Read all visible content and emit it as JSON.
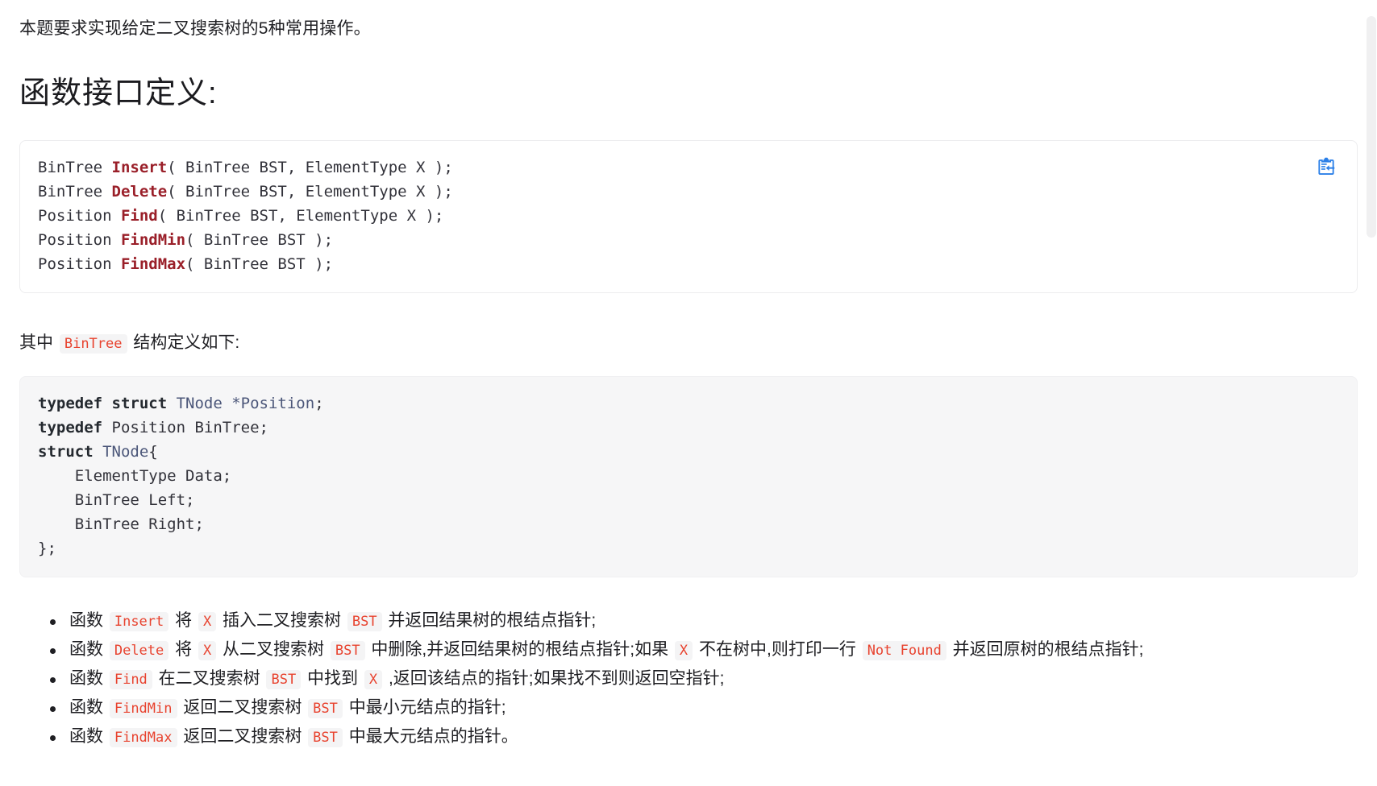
{
  "intro": {
    "text": "本题要求实现给定二叉搜索树的5种常用操作。"
  },
  "heading": {
    "text": "函数接口定义:"
  },
  "code_block_1": {
    "lines": [
      {
        "parts": [
          {
            "t": "BinTree ",
            "c": "plain"
          },
          {
            "t": "Insert",
            "c": "fn"
          },
          {
            "t": "( BinTree BST, ElementType X );",
            "c": "plain"
          }
        ]
      },
      {
        "parts": [
          {
            "t": "BinTree ",
            "c": "plain"
          },
          {
            "t": "Delete",
            "c": "fn"
          },
          {
            "t": "( BinTree BST, ElementType X );",
            "c": "plain"
          }
        ]
      },
      {
        "parts": [
          {
            "t": "Position ",
            "c": "plain"
          },
          {
            "t": "Find",
            "c": "fn"
          },
          {
            "t": "( BinTree BST, ElementType X );",
            "c": "plain"
          }
        ]
      },
      {
        "parts": [
          {
            "t": "Position ",
            "c": "plain"
          },
          {
            "t": "FindMin",
            "c": "fn"
          },
          {
            "t": "( BinTree BST );",
            "c": "plain"
          }
        ]
      },
      {
        "parts": [
          {
            "t": "Position ",
            "c": "plain"
          },
          {
            "t": "FindMax",
            "c": "fn"
          },
          {
            "t": "( BinTree BST );",
            "c": "plain"
          }
        ]
      }
    ],
    "copy_icon": "copy-to-clipboard-icon",
    "copy_icon_color": "#2a7fe8"
  },
  "mid_paragraph": {
    "before": "其中",
    "code": "BinTree",
    "after": "结构定义如下:"
  },
  "code_block_2": {
    "lines": [
      {
        "parts": [
          {
            "t": "typedef struct ",
            "c": "kw"
          },
          {
            "t": "TNode ",
            "c": "type"
          },
          {
            "t": "*Position",
            "c": "type"
          },
          {
            "t": ";",
            "c": "plain"
          }
        ]
      },
      {
        "parts": [
          {
            "t": "typedef ",
            "c": "kw"
          },
          {
            "t": "Position BinTree;",
            "c": "plain"
          }
        ]
      },
      {
        "parts": [
          {
            "t": "struct ",
            "c": "kw"
          },
          {
            "t": "TNode",
            "c": "type"
          },
          {
            "t": "{",
            "c": "plain"
          }
        ]
      },
      {
        "parts": [
          {
            "t": "    ElementType Data;",
            "c": "plain"
          }
        ]
      },
      {
        "parts": [
          {
            "t": "    BinTree Left;",
            "c": "plain"
          }
        ]
      },
      {
        "parts": [
          {
            "t": "    BinTree Right;",
            "c": "plain"
          }
        ]
      },
      {
        "parts": [
          {
            "t": "};",
            "c": "plain"
          }
        ]
      }
    ]
  },
  "spec_list": {
    "items": [
      {
        "segments": [
          {
            "type": "text",
            "v": "函数 "
          },
          {
            "type": "code",
            "v": "Insert"
          },
          {
            "type": "text",
            "v": " 将 "
          },
          {
            "type": "code",
            "v": "X"
          },
          {
            "type": "text",
            "v": " 插入二叉搜索树 "
          },
          {
            "type": "code",
            "v": "BST"
          },
          {
            "type": "text",
            "v": " 并返回结果树的根结点指针;"
          }
        ]
      },
      {
        "segments": [
          {
            "type": "text",
            "v": "函数 "
          },
          {
            "type": "code",
            "v": "Delete"
          },
          {
            "type": "text",
            "v": " 将 "
          },
          {
            "type": "code",
            "v": "X"
          },
          {
            "type": "text",
            "v": " 从二叉搜索树 "
          },
          {
            "type": "code",
            "v": "BST"
          },
          {
            "type": "text",
            "v": " 中删除,并返回结果树的根结点指针;如果 "
          },
          {
            "type": "code",
            "v": "X"
          },
          {
            "type": "text",
            "v": " 不在树中,则打印一行 "
          },
          {
            "type": "code",
            "v": "Not Found"
          },
          {
            "type": "text",
            "v": " 并返回原树的根结点指针;"
          }
        ]
      },
      {
        "segments": [
          {
            "type": "text",
            "v": "函数 "
          },
          {
            "type": "code",
            "v": "Find"
          },
          {
            "type": "text",
            "v": " 在二叉搜索树 "
          },
          {
            "type": "code",
            "v": "BST"
          },
          {
            "type": "text",
            "v": " 中找到 "
          },
          {
            "type": "code",
            "v": "X"
          },
          {
            "type": "text",
            "v": " ,返回该结点的指针;如果找不到则返回空指针;"
          }
        ]
      },
      {
        "segments": [
          {
            "type": "text",
            "v": "函数 "
          },
          {
            "type": "code",
            "v": "FindMin"
          },
          {
            "type": "text",
            "v": " 返回二叉搜索树 "
          },
          {
            "type": "code",
            "v": "BST"
          },
          {
            "type": "text",
            "v": " 中最小元结点的指针;"
          }
        ]
      },
      {
        "segments": [
          {
            "type": "text",
            "v": "函数 "
          },
          {
            "type": "code",
            "v": "FindMax"
          },
          {
            "type": "text",
            "v": " 返回二叉搜索树 "
          },
          {
            "type": "code",
            "v": "BST"
          },
          {
            "type": "text",
            "v": " 中最大元结点的指针。"
          }
        ]
      }
    ]
  },
  "scrollbar": {
    "name": "vertical-scrollbar"
  }
}
